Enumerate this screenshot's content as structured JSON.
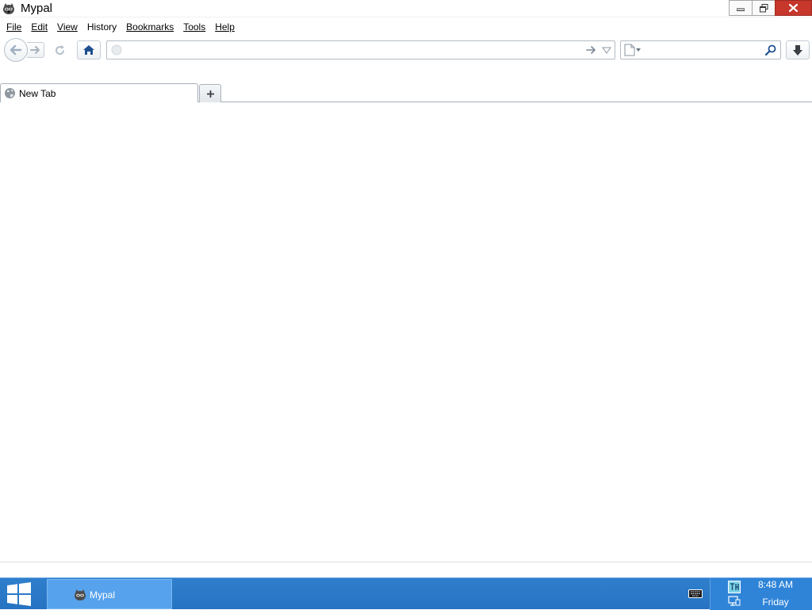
{
  "window": {
    "title": "Mypal",
    "app_icon": "mypal-raccoon-icon",
    "controls": [
      "minimize-icon",
      "restore-icon",
      "close-icon"
    ]
  },
  "menubar": {
    "items": [
      {
        "label": "File",
        "accesskey": "F"
      },
      {
        "label": "Edit",
        "accesskey": "E"
      },
      {
        "label": "View",
        "accesskey": "V"
      },
      {
        "label": "History",
        "accesskey": "s"
      },
      {
        "label": "Bookmarks",
        "accesskey": "B"
      },
      {
        "label": "Tools",
        "accesskey": "T"
      },
      {
        "label": "Help",
        "accesskey": "H"
      }
    ]
  },
  "navbar": {
    "url_value": "",
    "url_placeholder": "",
    "search_value": "",
    "search_placeholder": "",
    "icons": [
      "back-arrow-icon",
      "forward-arrow-icon",
      "reload-icon",
      "home-icon",
      "identity-globe-icon",
      "go-arrow-icon",
      "dropdown-arrow-icon",
      "search-engine-page-icon",
      "magnifier-icon",
      "download-arrow-icon"
    ]
  },
  "tabs": {
    "items": [
      {
        "label": "New Tab",
        "icon": "globe-icon",
        "selected": true
      }
    ],
    "new_tab_icon": "plus-icon"
  },
  "taskbar": {
    "start_icon": "windows-logo-icon",
    "items": [
      {
        "label": "Mypal",
        "icon": "mypal-raccoon-icon",
        "active": true
      }
    ],
    "tray": {
      "time": "8:48 AM",
      "day": "Friday",
      "icons": [
        "keyboard-icon",
        "tray-app-icon",
        "network-icon"
      ]
    }
  },
  "colors": {
    "taskbar": "#2673c2",
    "task_item_active": "#56a2ec",
    "close_button": "#c7372c",
    "home_icon": "#1f4f8f"
  }
}
